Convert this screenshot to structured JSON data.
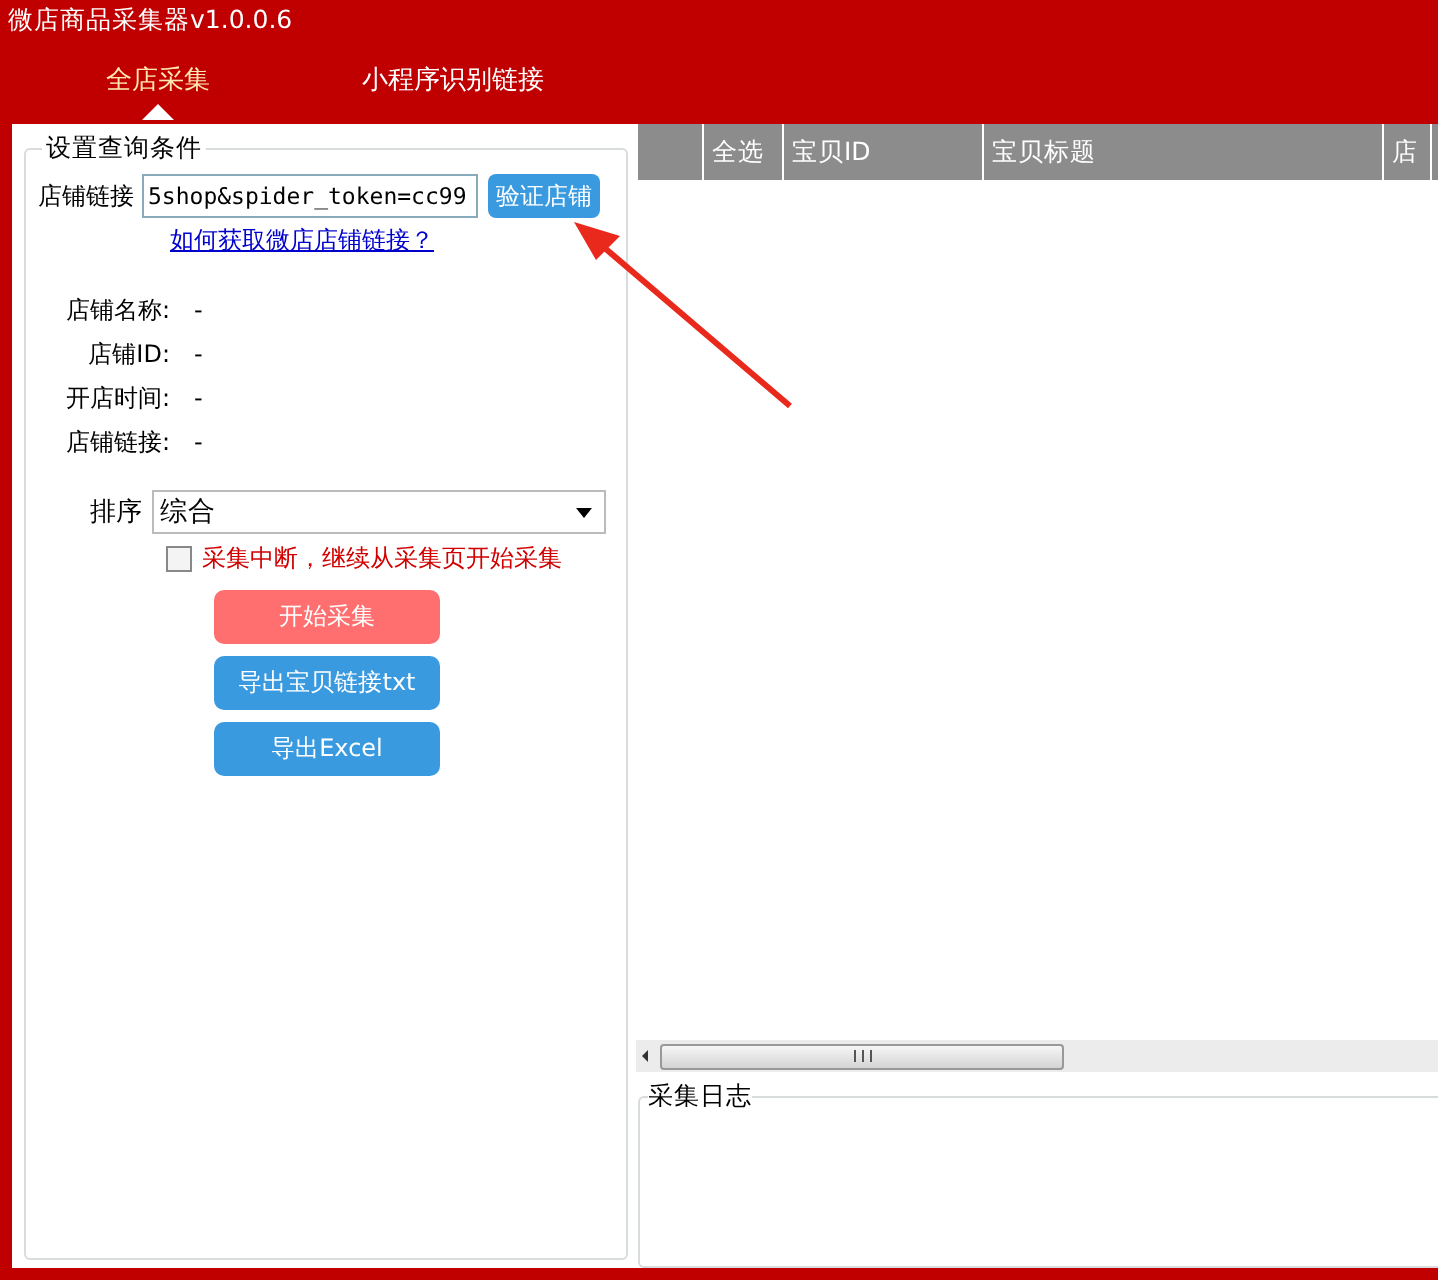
{
  "window": {
    "title": "微店商品采集器v1.0.0.6"
  },
  "tabs": [
    {
      "label": "全店采集",
      "selected": true
    },
    {
      "label": "小程序识别链接",
      "selected": false
    }
  ],
  "query": {
    "title": "设置查询条件",
    "link_label": "店铺链接",
    "link_value": "5shop&spider_token=cc99",
    "verify_button": "验证店铺",
    "help_link": "如何获取微店店铺链接？",
    "info": [
      {
        "label": "店铺名称:",
        "value": "-"
      },
      {
        "label": "店铺ID:",
        "value": "-"
      },
      {
        "label": "开店时间:",
        "value": "-"
      },
      {
        "label": "店铺链接:",
        "value": "-"
      }
    ],
    "sort_label": "排序",
    "sort_value": "综合",
    "resume": {
      "label": "采集中断，继续从采集页开始采集",
      "checked": false
    },
    "buttons": [
      {
        "label": "开始采集",
        "kind": "primary"
      },
      {
        "label": "导出宝贝链接txt",
        "kind": "secondary"
      },
      {
        "label": "导出Excel",
        "kind": "secondary"
      }
    ]
  },
  "table": {
    "columns": [
      "",
      "全选",
      "宝贝ID",
      "宝贝标题",
      "店"
    ]
  },
  "log": {
    "title": "采集日志"
  }
}
